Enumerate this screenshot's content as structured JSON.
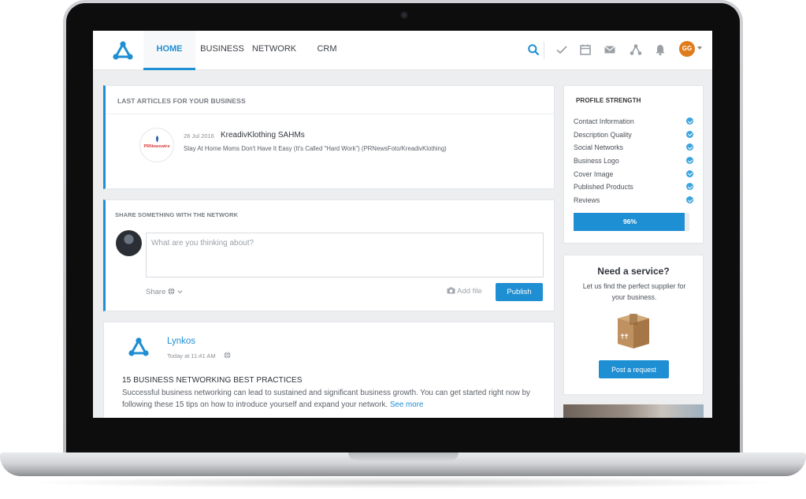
{
  "nav": {
    "tabs": [
      {
        "label": "HOME",
        "active": true
      },
      {
        "label": "BUSINESS",
        "active": false
      },
      {
        "label": "NETWORK",
        "active": false
      },
      {
        "label": "CRM",
        "active": false
      }
    ],
    "user_initials": "GG",
    "icons": [
      "search-icon",
      "check-icon",
      "calendar-icon",
      "mail-icon",
      "network-icon",
      "bell-icon"
    ]
  },
  "articles": {
    "title": "LAST ARTICLES FOR YOUR BUSINESS",
    "items": [
      {
        "logo_text": "PRNewswire",
        "date": "28 Jul 2016",
        "title": "KreadivKlothing SAHMs",
        "description": "Stay At Home Moms Don't Have It Easy (It's Called \"Hard Work\") (PRNewsFoto/KreadivKlothing)"
      }
    ]
  },
  "share": {
    "title": "SHARE SOMETHING WITH THE NETWORK",
    "placeholder": "What are you thinking about?",
    "privacy_label": "Share",
    "add_file_label": "Add file",
    "publish_label": "Publish"
  },
  "post": {
    "author": "Lynkos",
    "time": "Today at 11:41 AM",
    "heading": "15 BUSINESS NETWORKING BEST PRACTICES",
    "body": "Successful business networking can lead to sustained and significant business growth. You can get started right now by following these 15 tips on how to introduce yourself and expand your network.",
    "see_more": "See more"
  },
  "profile_strength": {
    "title": "PROFILE STRENGTH",
    "items": [
      {
        "label": "Contact Information",
        "done": true
      },
      {
        "label": "Description Quality",
        "done": true
      },
      {
        "label": "Social Networks",
        "done": true
      },
      {
        "label": "Business Logo",
        "done": true
      },
      {
        "label": "Cover Image",
        "done": true
      },
      {
        "label": "Published Products",
        "done": true
      },
      {
        "label": "Reviews",
        "done": true
      }
    ],
    "progress_label": "96%",
    "progress_value": 0.96
  },
  "service": {
    "title": "Need a service?",
    "description": "Let us find the perfect supplier for your business.",
    "button_label": "Post a request"
  },
  "colors": {
    "accent": "#1f8fd3",
    "avatar": "#e07b1c"
  }
}
